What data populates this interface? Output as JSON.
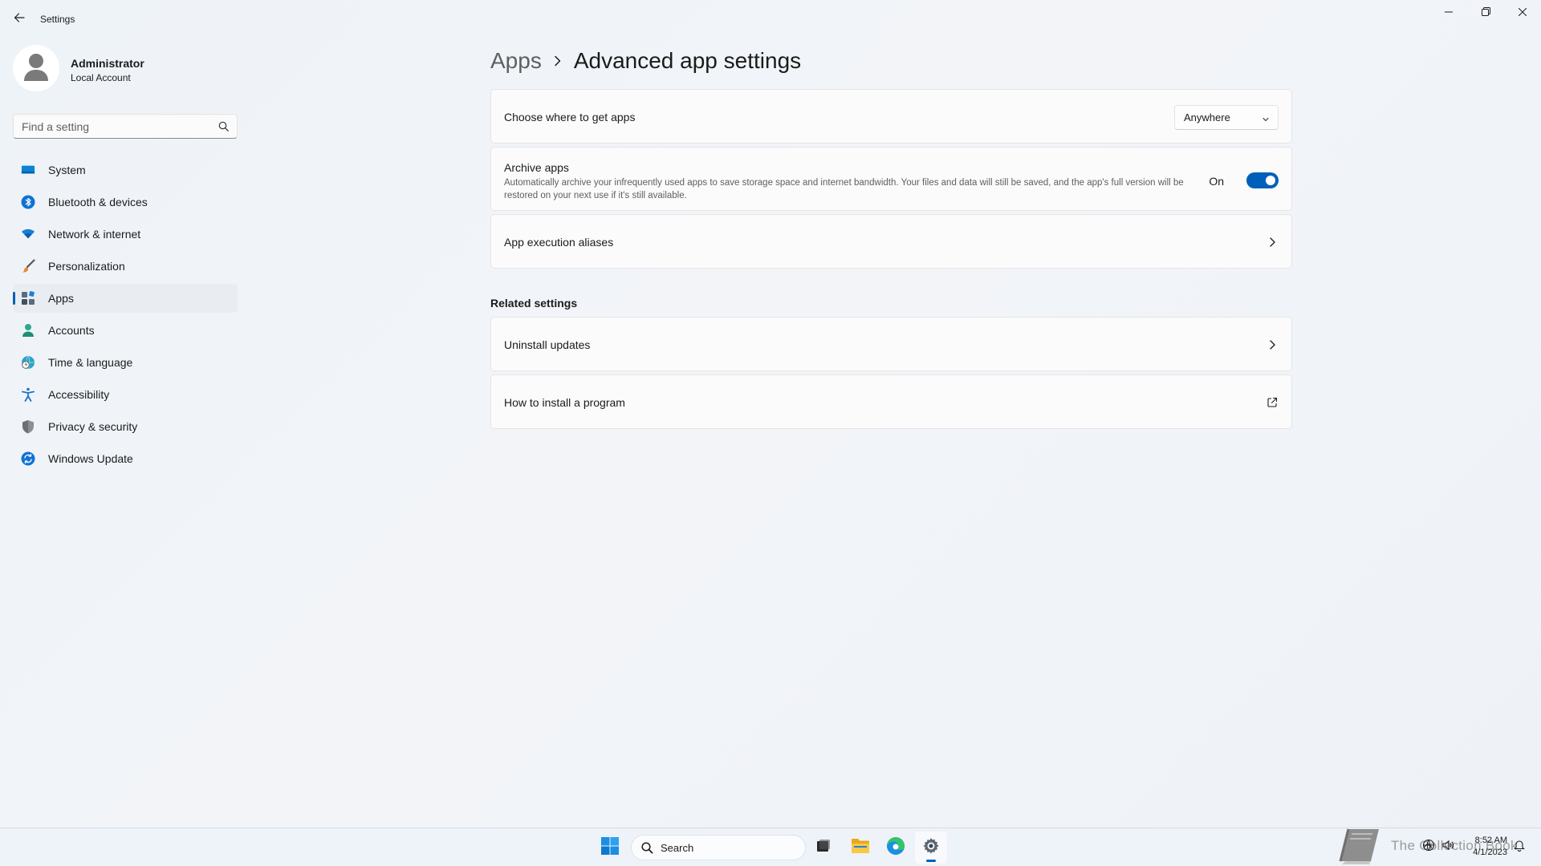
{
  "window": {
    "title": "Settings",
    "back_icon": "arrow-left-icon",
    "minimize_icon": "minimize-icon",
    "maximize_icon": "restore-icon",
    "close_icon": "close-icon"
  },
  "profile": {
    "name": "Administrator",
    "account_type": "Local Account"
  },
  "search": {
    "placeholder": "Find a setting"
  },
  "sidebar": {
    "items": [
      {
        "label": "System",
        "icon": "system-icon",
        "active": false
      },
      {
        "label": "Bluetooth & devices",
        "icon": "bluetooth-icon",
        "active": false
      },
      {
        "label": "Network & internet",
        "icon": "wifi-icon",
        "active": false
      },
      {
        "label": "Personalization",
        "icon": "brush-icon",
        "active": false
      },
      {
        "label": "Apps",
        "icon": "apps-icon",
        "active": true
      },
      {
        "label": "Accounts",
        "icon": "person-icon",
        "active": false
      },
      {
        "label": "Time & language",
        "icon": "globe-clock-icon",
        "active": false
      },
      {
        "label": "Accessibility",
        "icon": "accessibility-icon",
        "active": false
      },
      {
        "label": "Privacy & security",
        "icon": "shield-icon",
        "active": false
      },
      {
        "label": "Windows Update",
        "icon": "update-icon",
        "active": false
      }
    ]
  },
  "main": {
    "breadcrumb": {
      "parent": "Apps",
      "current": "Advanced app settings"
    },
    "settings": {
      "choose_source": {
        "label": "Choose where to get apps",
        "selected": "Anywhere"
      },
      "archive_apps": {
        "label": "Archive apps",
        "description": "Automatically archive your infrequently used apps to save storage space and internet bandwidth. Your files and data will still be saved, and the app's full version will be restored on your next use if it's still available.",
        "state_label": "On",
        "enabled": true
      },
      "aliases": {
        "label": "App execution aliases"
      }
    },
    "related": {
      "heading": "Related settings",
      "items": [
        {
          "label": "Uninstall updates",
          "icon": "chevron-right-icon"
        },
        {
          "label": "How to install a program",
          "icon": "external-link-icon"
        }
      ]
    }
  },
  "taskbar": {
    "search_label": "Search",
    "watermark": "The Collection Book",
    "time": "8:52 AM",
    "date": "4/1/2023"
  },
  "colors": {
    "accent": "#005fb8",
    "background": "#f0f4f8",
    "card": "#fbfbfb"
  }
}
